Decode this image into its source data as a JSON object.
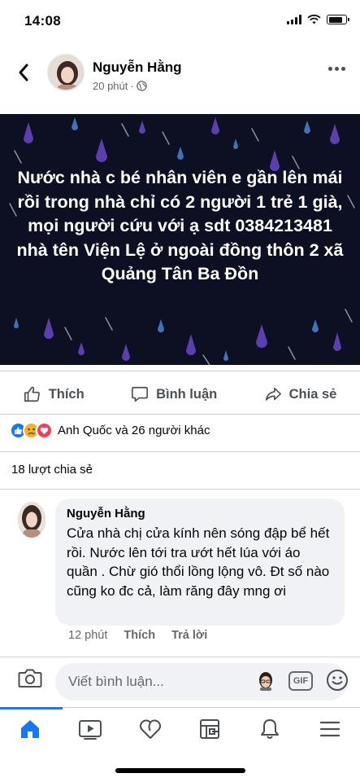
{
  "status_bar": {
    "time": "14:08"
  },
  "post": {
    "author": "Nguyễn Hằng",
    "time_ago": "20 phút",
    "separator": "·",
    "text": "Nước nhà c bé nhân viên e gần lên mái rồi trong nhà chỉ có 2 người 1 trẻ 1 già, mọi người cứu với ạ sdt 0384213481 nhà tên Viện Lệ ở ngoài đồng thôn 2 xã Quảng Tân Ba Đồn",
    "background_color": "#0d1022"
  },
  "actions": {
    "like": "Thích",
    "comment": "Bình luận",
    "share": "Chia sẻ"
  },
  "reactions": {
    "icons": [
      "like-icon",
      "sad-icon",
      "love-icon"
    ],
    "summary": "Anh Quốc và 26 người khác"
  },
  "shares": {
    "label": "18 lượt chia sẻ"
  },
  "comment": {
    "author": "Nguyễn Hằng",
    "text": "Cửa nhà chị cửa kính nên sóng đập bể hết rồi. Nước lên tới tra ướt hết lúa với áo quần . Chừ gió thổi lồng lộng vô. Đt số nào cũng ko đc cả, làm răng đây mng ơi",
    "time_ago": "12 phút",
    "like": "Thích",
    "reply": "Trả lời"
  },
  "composer": {
    "placeholder": "Viết bình luận...",
    "gif": "GIF"
  },
  "tabs": [
    {
      "name": "home-icon",
      "active": true
    },
    {
      "name": "watch-icon",
      "active": false
    },
    {
      "name": "dating-icon",
      "active": false
    },
    {
      "name": "pages-icon",
      "active": false
    },
    {
      "name": "notifications-icon",
      "active": false
    },
    {
      "name": "menu-icon",
      "active": false
    }
  ],
  "colors": {
    "brand": "#1877f2",
    "text": "#050505",
    "secondary": "#65676b"
  }
}
